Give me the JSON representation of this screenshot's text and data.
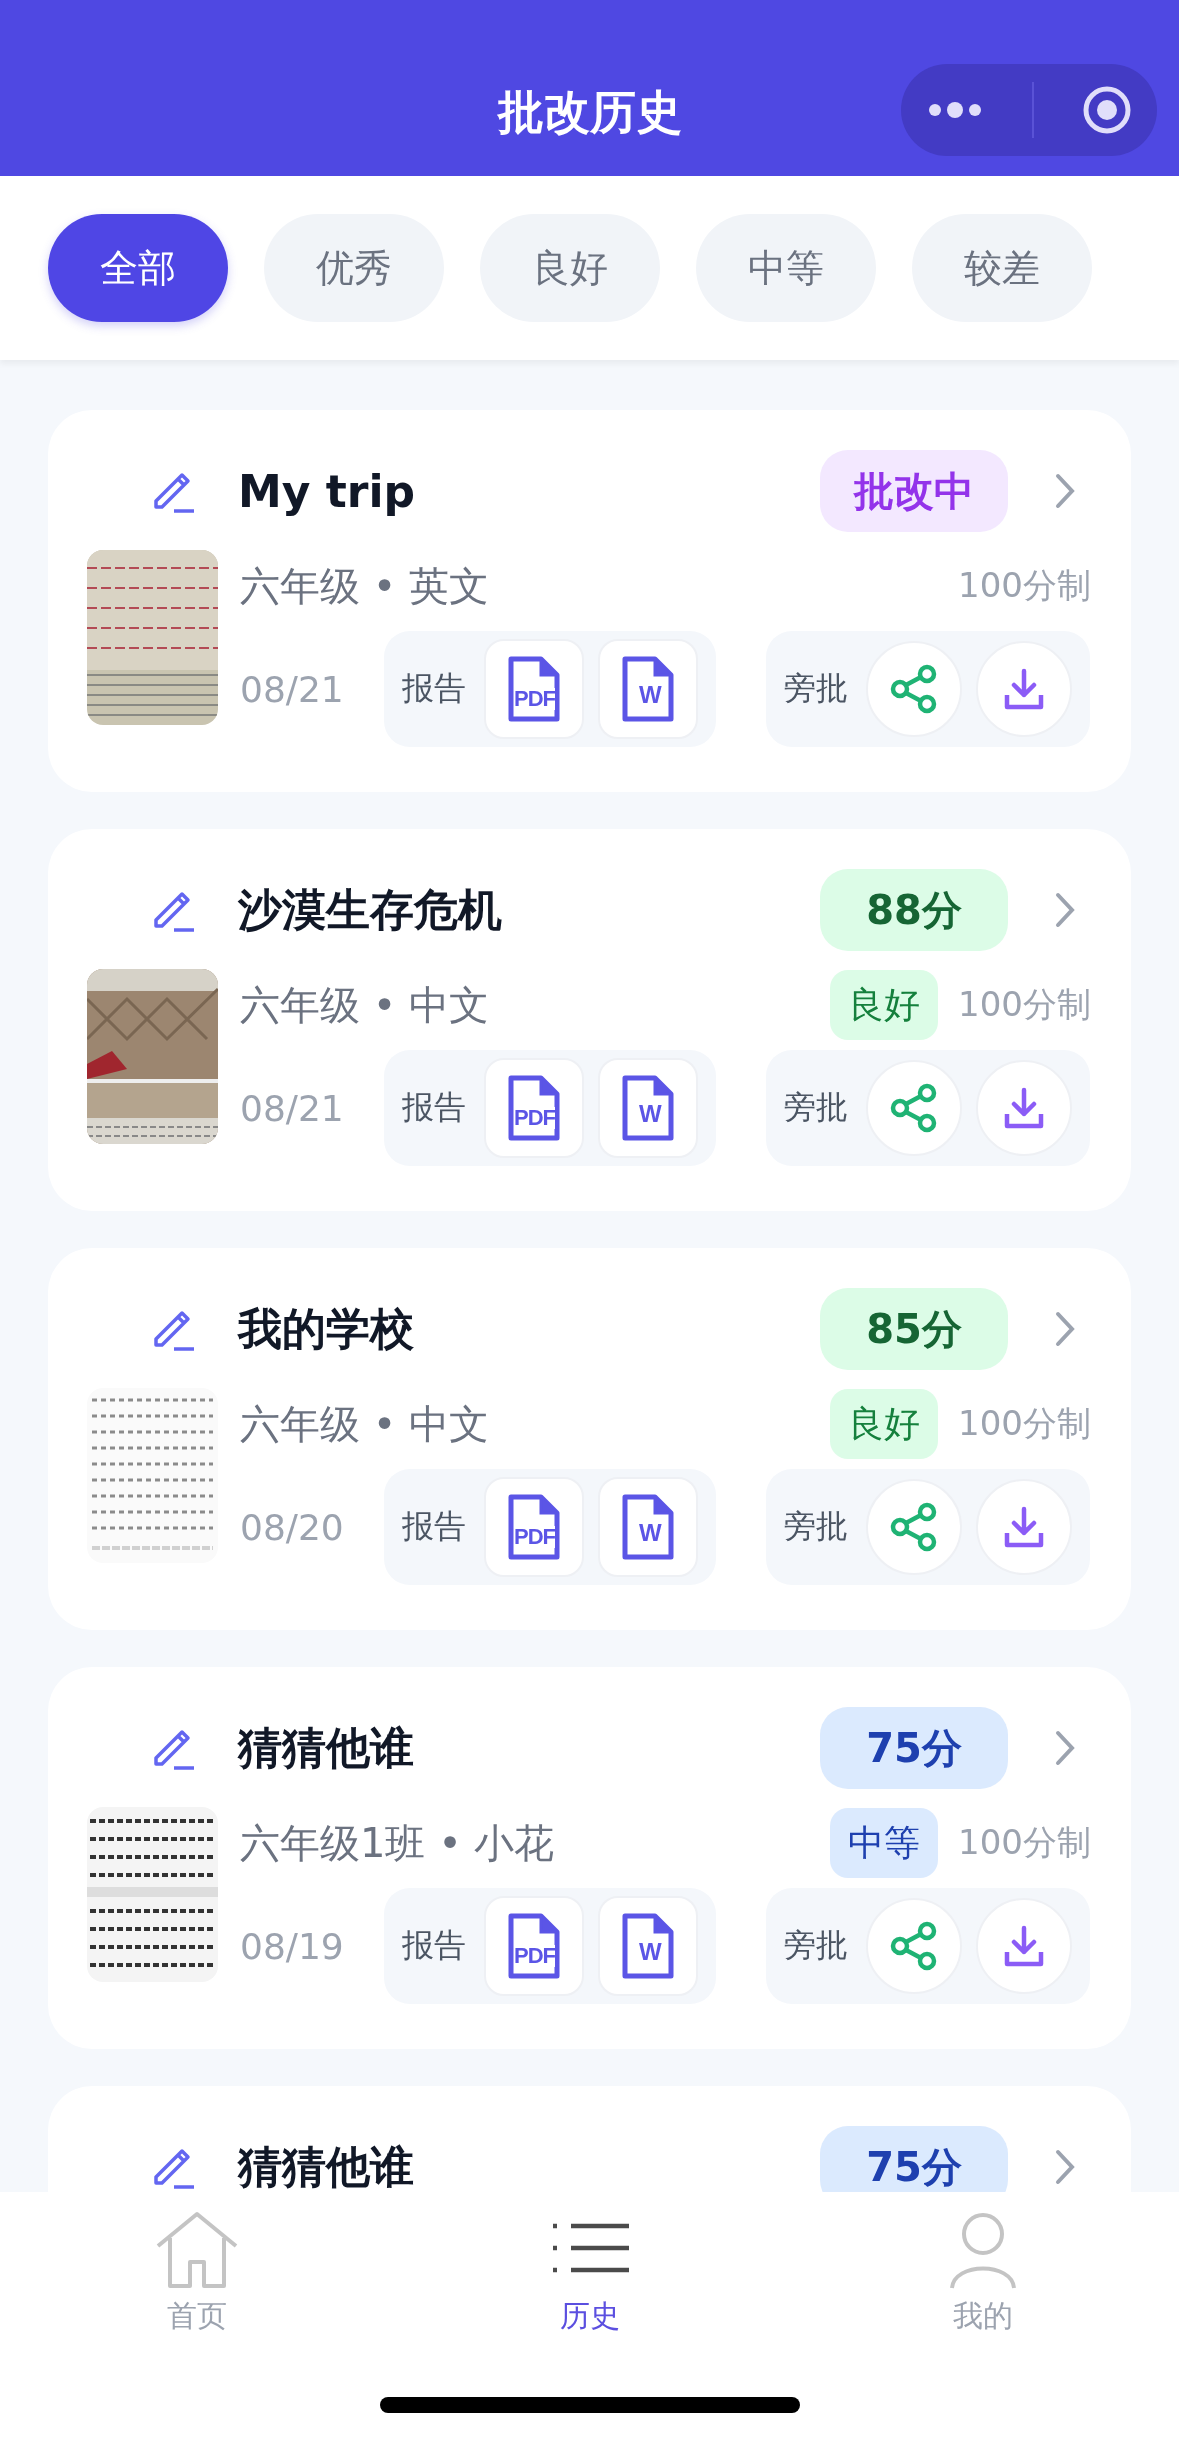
{
  "header": {
    "title": "批改历史"
  },
  "filters": [
    {
      "label": "全部",
      "selected": true
    },
    {
      "label": "优秀",
      "selected": false
    },
    {
      "label": "良好",
      "selected": false
    },
    {
      "label": "中等",
      "selected": false
    },
    {
      "label": "较差",
      "selected": false
    }
  ],
  "cards": [
    {
      "title": "My trip",
      "status": {
        "text": "批改中",
        "kind": "pending"
      },
      "meta": "六年级 • 英文",
      "scale": "100分制",
      "date": "08/21",
      "report": {
        "label": "报告",
        "files": [
          "PDF",
          "W"
        ]
      },
      "annotate": {
        "label": "旁批"
      }
    },
    {
      "title": "沙漠生存危机",
      "status": {
        "text": "88分",
        "kind": "good"
      },
      "meta": "六年级 • 中文",
      "grade": {
        "text": "良好",
        "kind": "good"
      },
      "scale": "100分制",
      "date": "08/21",
      "report": {
        "label": "报告",
        "files": [
          "PDF",
          "W"
        ]
      },
      "annotate": {
        "label": "旁批"
      }
    },
    {
      "title": "我的学校",
      "status": {
        "text": "85分",
        "kind": "good"
      },
      "meta": "六年级 • 中文",
      "grade": {
        "text": "良好",
        "kind": "good"
      },
      "scale": "100分制",
      "date": "08/20",
      "report": {
        "label": "报告",
        "files": [
          "PDF",
          "W"
        ]
      },
      "annotate": {
        "label": "旁批"
      }
    },
    {
      "title": "猜猜他谁",
      "status": {
        "text": "75分",
        "kind": "medium"
      },
      "meta": "六年级1班 • 小花",
      "grade": {
        "text": "中等",
        "kind": "medium"
      },
      "scale": "100分制",
      "date": "08/19",
      "report": {
        "label": "报告",
        "files": [
          "PDF",
          "W"
        ]
      },
      "annotate": {
        "label": "旁批"
      }
    },
    {
      "title": "猜猜他谁",
      "status": {
        "text": "75分",
        "kind": "medium"
      }
    }
  ],
  "tabs": [
    {
      "label": "首页",
      "selected": false
    },
    {
      "label": "历史",
      "selected": true
    },
    {
      "label": "我的",
      "selected": false
    }
  ]
}
